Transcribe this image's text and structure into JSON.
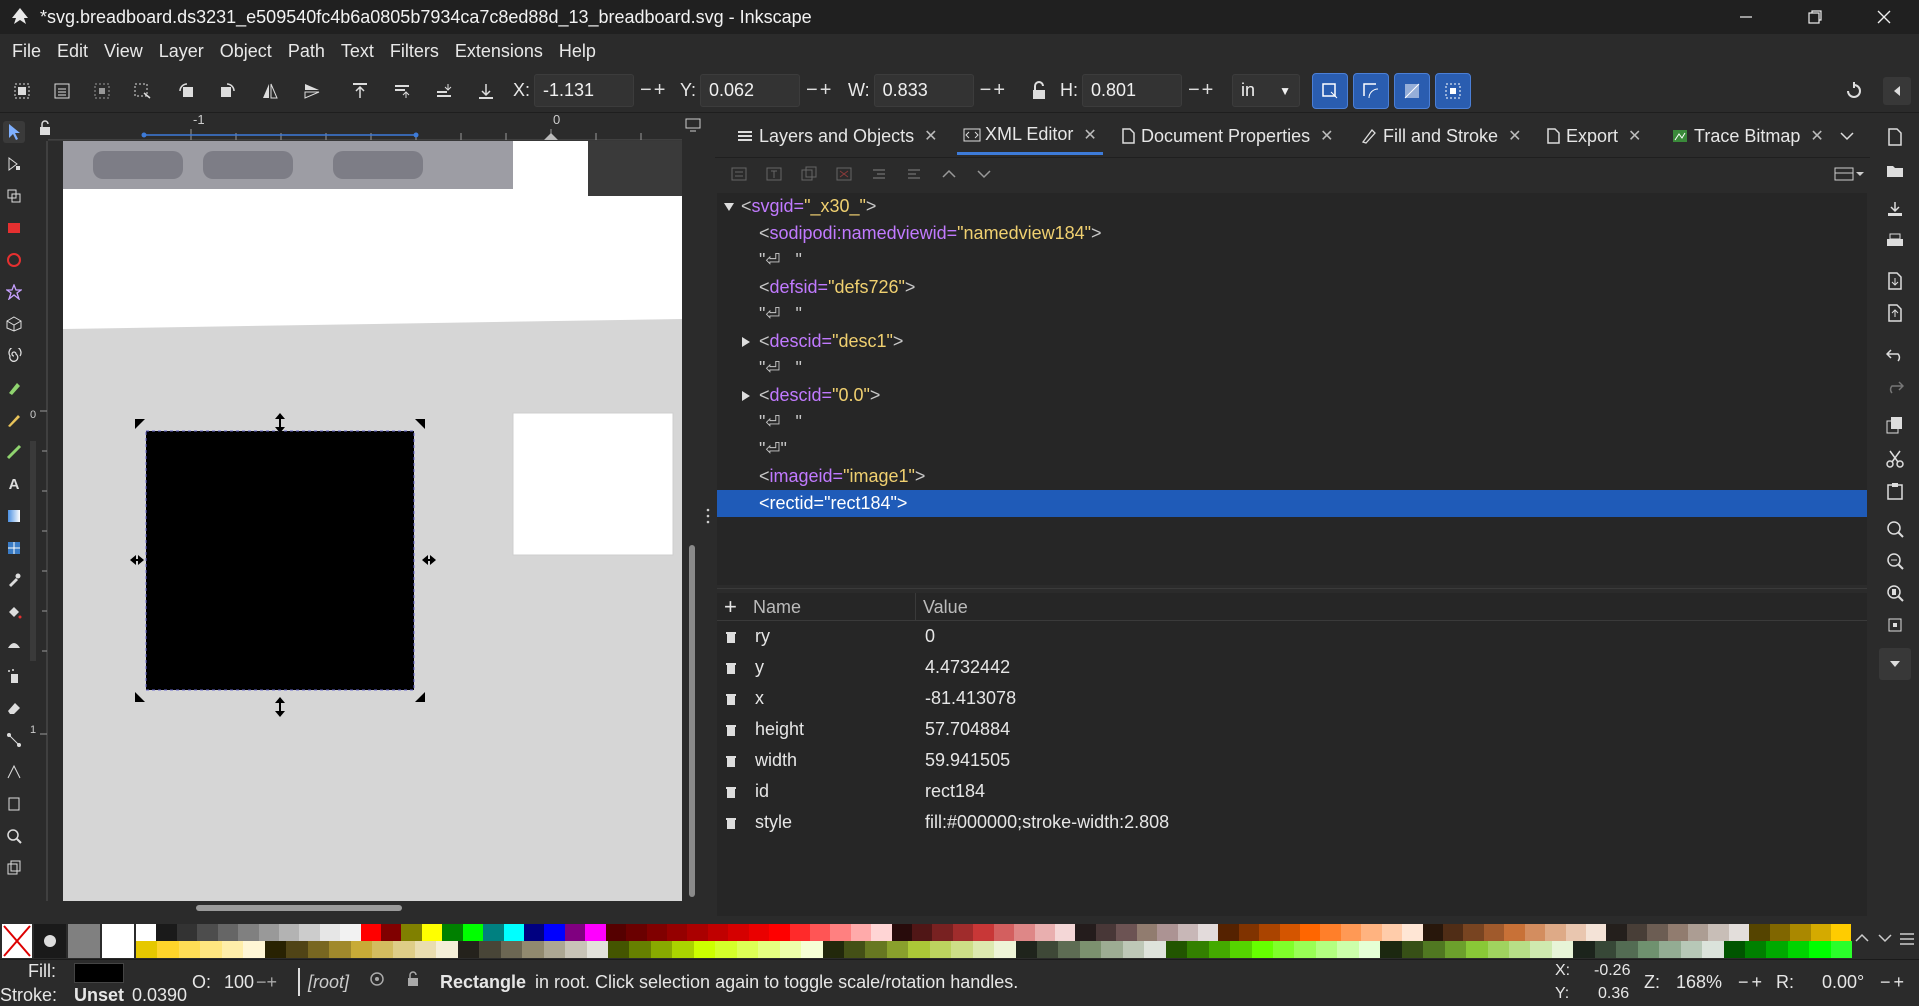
{
  "window": {
    "title": "*svg.breadboard.ds3231_e509540fc4b6a0805b7934ca7c8ed88d_13_breadboard.svg - Inkscape"
  },
  "menu": [
    "File",
    "Edit",
    "View",
    "Layer",
    "Object",
    "Path",
    "Text",
    "Filters",
    "Extensions",
    "Help"
  ],
  "toolbar": {
    "x_label": "X:",
    "x": "-1.131",
    "y_label": "Y:",
    "y": "0.062",
    "w_label": "W:",
    "w": "0.833",
    "h_label": "H:",
    "h": "0.801",
    "unit": "in"
  },
  "ruler": {
    "h_m1": "-1",
    "h_0": "0",
    "v_0": "0",
    "v_m1": "1"
  },
  "tabs": [
    {
      "label": "Layers and Objects",
      "icon": "layers-icon"
    },
    {
      "label": "XML Editor",
      "icon": "xml-icon"
    },
    {
      "label": "Document Properties",
      "icon": "document-icon"
    },
    {
      "label": "Fill and Stroke",
      "icon": "fill-stroke-icon"
    },
    {
      "label": "Export",
      "icon": "export-icon"
    },
    {
      "label": "Trace Bitmap",
      "icon": "trace-bitmap-icon"
    }
  ],
  "xml_tree": [
    {
      "open": "<",
      "tag": "svg",
      "attr": " id=",
      "val": "\"_x30_\"",
      "close": ">",
      "arrow": "down"
    },
    {
      "open": "<",
      "tag": "sodipodi:namedview",
      "attr": " id=",
      "val": "\"namedview184\"",
      "close": ">",
      "arrow": ""
    },
    {
      "open": "\"",
      "tag": "⏎",
      "attr": "   ",
      "val": "",
      "close": "\"",
      "arrow": ""
    },
    {
      "open": "<",
      "tag": "defs",
      "attr": " id=",
      "val": "\"defs726\"",
      "close": ">",
      "arrow": ""
    },
    {
      "open": "\"",
      "tag": "⏎",
      "attr": "   ",
      "val": "",
      "close": "\"",
      "arrow": ""
    },
    {
      "open": "<",
      "tag": "desc",
      "attr": " id=",
      "val": "\"desc1\"",
      "close": ">",
      "arrow": "right"
    },
    {
      "open": "\"",
      "tag": "⏎",
      "attr": "   ",
      "val": "",
      "close": "\"",
      "arrow": ""
    },
    {
      "open": "<",
      "tag": "desc",
      "attr": " id=",
      "val": "\"0.0\"",
      "close": ">",
      "arrow": "right"
    },
    {
      "open": "\"",
      "tag": "⏎",
      "attr": "   ",
      "val": "",
      "close": "\"",
      "arrow": ""
    },
    {
      "open": "\"",
      "tag": "⏎",
      "attr": "",
      "val": "",
      "close": "\"",
      "arrow": ""
    },
    {
      "open": "<",
      "tag": "image",
      "attr": " id=",
      "val": "\"image1\"",
      "close": ">",
      "arrow": ""
    },
    {
      "open": "<",
      "tag": "rect",
      "attr": " id=",
      "val": "\"rect184\"",
      "close": ">",
      "arrow": "",
      "selected": true
    }
  ],
  "attributes": {
    "header_name": "Name",
    "header_value": "Value",
    "rows": [
      {
        "name": "ry",
        "value": "0"
      },
      {
        "name": "y",
        "value": "4.4732442"
      },
      {
        "name": "x",
        "value": "-81.413078"
      },
      {
        "name": "height",
        "value": "57.704884"
      },
      {
        "name": "width",
        "value": "59.941505"
      },
      {
        "name": "id",
        "value": "rect184"
      },
      {
        "name": "style",
        "value": "fill:#000000;stroke-width:2.808"
      }
    ]
  },
  "status": {
    "fill_label": "Fill:",
    "stroke_label": "Stroke:",
    "stroke_value": "Unset",
    "stroke_width": "0.0390",
    "opacity_label": "O:",
    "opacity": "100",
    "layer": "[root]",
    "msg_bold": "Rectangle",
    "msg": " in root. Click selection again to toggle scale/rotation handles.",
    "cx_label": "X:",
    "cx": "-0.26",
    "cy_label": "Y:",
    "cy": "0.36",
    "zoom_label": "Z:",
    "zoom": "168%",
    "rot_label": "R:",
    "rot": "0.00°"
  },
  "palette_row1": [
    "#ffffff",
    "#1a1a1a",
    "#333333",
    "#4d4d4d",
    "#666666",
    "#808080",
    "#999999",
    "#b3b3b3",
    "#cccccc",
    "#e6e6e6",
    "#f2f2f2",
    "#ff0000",
    "#800000",
    "#808000",
    "#ffff00",
    "#008000",
    "#00ff00",
    "#008080",
    "#00ffff",
    "#000080",
    "#0000ff",
    "#800080",
    "#ff00ff",
    "#550000",
    "#6a0000",
    "#800000",
    "#950000",
    "#aa0000",
    "#c00000",
    "#d50000",
    "#ea0000",
    "#ff0000",
    "#ff2a2a",
    "#ff5555",
    "#ff8080",
    "#ffaaaa",
    "#ffd5d5",
    "#280b0b",
    "#501616",
    "#782121",
    "#a02c2c",
    "#c83737",
    "#d35f5f",
    "#de8787",
    "#e9afaf",
    "#f4d7d7",
    "#241c1c",
    "#483737",
    "#6c5353",
    "#917c6f",
    "#ac9393",
    "#c8b7b7",
    "#e3dbdb",
    "#552200",
    "#803300",
    "#aa4400",
    "#d45500",
    "#ff6600",
    "#ff7f2a",
    "#ff9955",
    "#ffb380",
    "#ffccaa",
    "#ffe6d5",
    "#28170b",
    "#502d16",
    "#784421",
    "#a05a2c",
    "#c87137",
    "#d38d5f",
    "#deaa87",
    "#e9c6af",
    "#f4e3d7",
    "#241f1c",
    "#483e37",
    "#6c5d53",
    "#917c6f",
    "#ac9d93",
    "#c8beb7",
    "#e3dedb",
    "#554400",
    "#806600",
    "#aa8800",
    "#d4aa00",
    "#ffcc00"
  ],
  "palette_row2": [
    "#e6c800",
    "#ffd42a",
    "#ffdd55",
    "#ffe680",
    "#ffeeaa",
    "#fff6d5",
    "#282202",
    "#504416",
    "#786721",
    "#a0892c",
    "#c8ab37",
    "#d3bc5f",
    "#decd87",
    "#e9ddaf",
    "#f4eed7",
    "#24221c",
    "#484537",
    "#6c6753",
    "#918a6f",
    "#aca793",
    "#c8c4b7",
    "#e3e2db",
    "#445500",
    "#668000",
    "#88aa00",
    "#aad400",
    "#ccff00",
    "#d4ff2a",
    "#ddff55",
    "#e5ff80",
    "#eeffaa",
    "#f6ffd5",
    "#22280b",
    "#445016",
    "#677821",
    "#89a02c",
    "#abc837",
    "#bcd35f",
    "#cdde87",
    "#dde9af",
    "#eef4d7",
    "#1f241c",
    "#3e4837",
    "#5d6c53",
    "#7c916f",
    "#9dac93",
    "#bec8b7",
    "#dee3db",
    "#225500",
    "#338000",
    "#44aa00",
    "#55d400",
    "#66ff00",
    "#7fff2a",
    "#99ff55",
    "#b3ff80",
    "#ccffaa",
    "#e5ffd5",
    "#1c2810",
    "#375016",
    "#507821",
    "#6ca02c",
    "#89c837",
    "#a0d35f",
    "#b7de87",
    "#cfe9af",
    "#e7f4d7",
    "#1c241c",
    "#374837",
    "#536c53",
    "#6f916f",
    "#93ac93",
    "#b7c8b7",
    "#dbe3db",
    "#005500",
    "#008000",
    "#00aa00",
    "#00d400",
    "#00ff00",
    "#2aff2a"
  ]
}
